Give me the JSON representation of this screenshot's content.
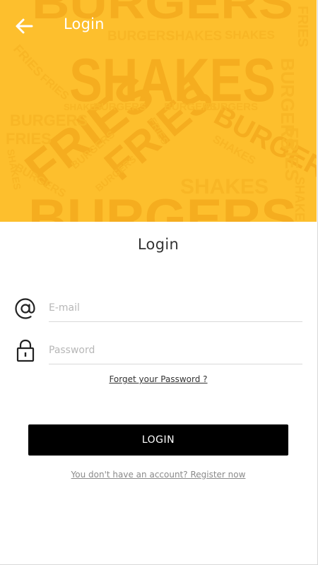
{
  "header": {
    "title": "Login",
    "back_icon": "arrow-left-icon"
  },
  "hero": {
    "background_color": "#fdbf2d",
    "pattern_color": "#f5ad1f",
    "pattern_words": {
      "burgers": "BURGERS",
      "shakes": "SHAKES",
      "fries": "FRIES"
    }
  },
  "form": {
    "heading": "Login",
    "email": {
      "placeholder": "E-mail",
      "value": "",
      "icon": "at-sign-icon"
    },
    "password": {
      "placeholder": "Password",
      "value": "",
      "icon": "lock-icon"
    },
    "forgot_password": "Forget your Password ?",
    "submit_label": "LOGIN",
    "register_prompt": "You don't have an account? Register now"
  },
  "colors": {
    "button": "#000000",
    "button_text": "#ffffff"
  }
}
